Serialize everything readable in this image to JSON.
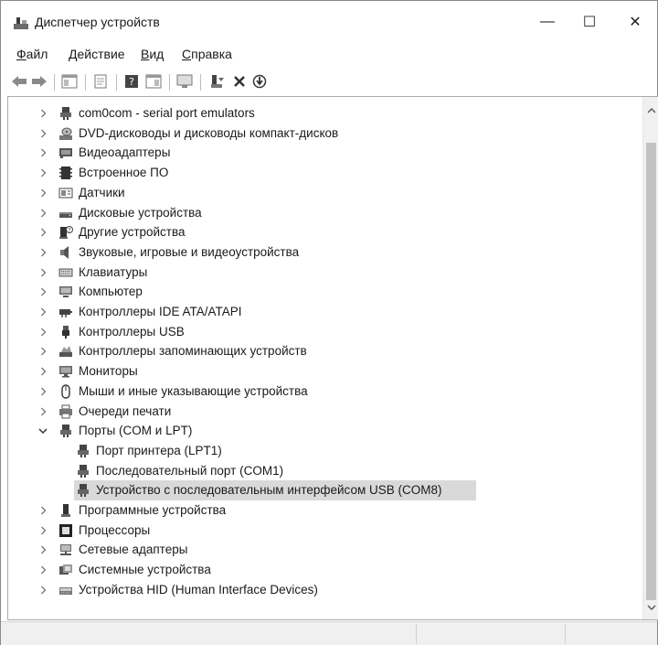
{
  "window": {
    "title": "Диспетчер устройств",
    "minimize": "—",
    "maximize": "☐",
    "close": "✕"
  },
  "menu": [
    {
      "key": "Ф",
      "rest": "айл"
    },
    {
      "key": "Д",
      "rest": "ействие"
    },
    {
      "key": "В",
      "rest": "ид"
    },
    {
      "key": "С",
      "rest": "правка"
    }
  ],
  "toolbar": {
    "back_icon": "back-arrow-icon",
    "forward_icon": "forward-arrow-icon"
  },
  "tree": [
    {
      "label": "com0com - serial port emulators",
      "icon": "port-icon",
      "expanded": false
    },
    {
      "label": "DVD-дисководы и дисководы компакт-дисков",
      "icon": "dvd-icon",
      "expanded": false
    },
    {
      "label": "Видеоадаптеры",
      "icon": "display-adapter-icon",
      "expanded": false
    },
    {
      "label": "Встроенное ПО",
      "icon": "firmware-icon",
      "expanded": false
    },
    {
      "label": "Датчики",
      "icon": "sensor-icon",
      "expanded": false
    },
    {
      "label": "Дисковые устройства",
      "icon": "disk-icon",
      "expanded": false
    },
    {
      "label": "Другие устройства",
      "icon": "unknown-device-icon",
      "expanded": false
    },
    {
      "label": "Звуковые, игровые и видеоустройства",
      "icon": "speaker-icon",
      "expanded": false
    },
    {
      "label": "Клавиатуры",
      "icon": "keyboard-icon",
      "expanded": false
    },
    {
      "label": "Компьютер",
      "icon": "computer-icon",
      "expanded": false
    },
    {
      "label": "Контроллеры IDE ATA/ATAPI",
      "icon": "ide-controller-icon",
      "expanded": false
    },
    {
      "label": "Контроллеры USB",
      "icon": "usb-icon",
      "expanded": false
    },
    {
      "label": "Контроллеры запоминающих устройств",
      "icon": "storage-controller-icon",
      "expanded": false
    },
    {
      "label": "Мониторы",
      "icon": "monitor-icon",
      "expanded": false
    },
    {
      "label": "Мыши и иные указывающие устройства",
      "icon": "mouse-icon",
      "expanded": false
    },
    {
      "label": "Очереди печати",
      "icon": "printer-icon",
      "expanded": false
    },
    {
      "label": "Порты (COM и LPT)",
      "icon": "port-icon",
      "expanded": true
    },
    {
      "label": "Порт принтера (LPT1)",
      "icon": "port-icon",
      "child": true
    },
    {
      "label": "Последовательный порт (COM1)",
      "icon": "port-icon",
      "child": true
    },
    {
      "label": "Устройство с последовательным интерфейсом USB (COM8)",
      "icon": "port-icon",
      "child": true,
      "selected": true
    },
    {
      "label": "Программные устройства",
      "icon": "software-device-icon",
      "expanded": false
    },
    {
      "label": "Процессоры",
      "icon": "processor-icon",
      "expanded": false
    },
    {
      "label": "Сетевые адаптеры",
      "icon": "network-adapter-icon",
      "expanded": false
    },
    {
      "label": "Системные устройства",
      "icon": "system-device-icon",
      "expanded": false
    },
    {
      "label": "Устройства HID (Human Interface Devices)",
      "icon": "hid-icon",
      "expanded": false
    }
  ]
}
